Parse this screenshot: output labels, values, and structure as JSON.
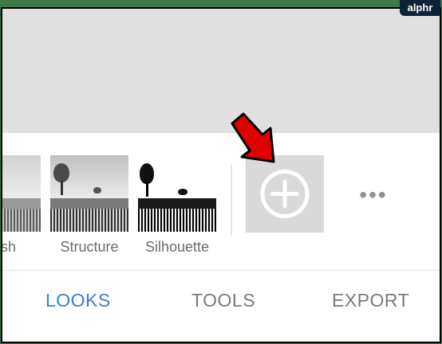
{
  "badge": {
    "text": "alphr"
  },
  "looks": [
    {
      "label": "sh"
    },
    {
      "label": "Structure"
    },
    {
      "label": "Silhouette"
    }
  ],
  "add_look": {
    "icon": "plus-circle-icon"
  },
  "more": {
    "label": "•••",
    "icon": "more-horizontal-icon"
  },
  "annotation": {
    "icon": "red-arrow-icon",
    "color": "#e00000"
  },
  "nav": {
    "tabs": [
      {
        "label": "LOOKS",
        "active": true
      },
      {
        "label": "TOOLS",
        "active": false
      },
      {
        "label": "EXPORT",
        "active": false
      }
    ]
  },
  "colors": {
    "accent": "#3b7dd8",
    "tab_inactive": "#7a7a7a",
    "preview_bg": "#e0e0e0",
    "add_tile_bg": "#d9d9d9"
  }
}
